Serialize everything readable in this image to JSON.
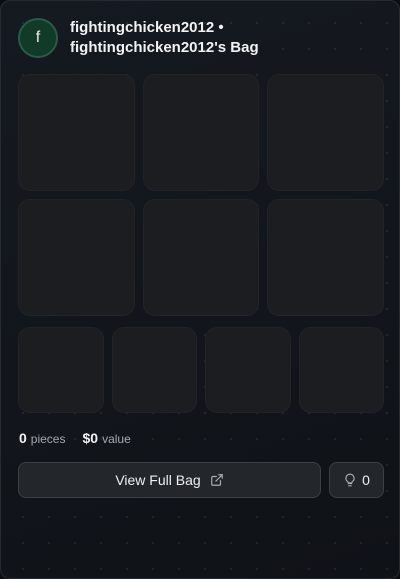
{
  "profile": {
    "avatar_letter": "f",
    "title": "fightingchicken2012 • fightingchicken2012's Bag"
  },
  "stats": {
    "pieces_count": "0",
    "pieces_label": "pieces",
    "value_amount": "$0",
    "value_label": "value"
  },
  "actions": {
    "view_full_bag_label": "View Full Bag",
    "like_count": "0"
  },
  "icons": {
    "external_link": "external-link-icon",
    "like": "lightbulb-icon"
  },
  "colors": {
    "avatar_bg": "#123a29",
    "tile_bg": "#1b1d20",
    "button_bg": "#23262b"
  }
}
